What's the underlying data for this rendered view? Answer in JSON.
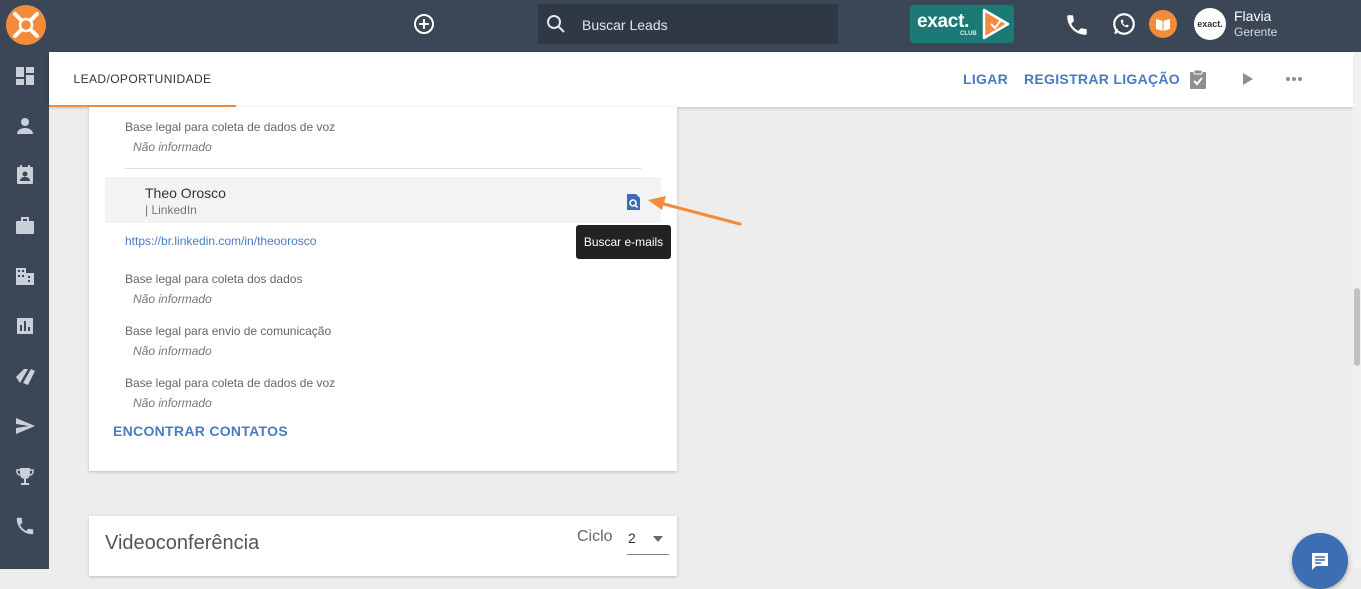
{
  "topbar": {
    "logo_icon": "exact-sales-logo-icon",
    "add_icon": "plus-circle-icon",
    "search_icon": "search-icon",
    "search_placeholder": "Buscar Leads",
    "club_brand": "exact.",
    "club_subtext": "CLUB",
    "phone_icon": "phone-icon",
    "whatsapp_icon": "whatsapp-icon",
    "learning_icon": "book-icon",
    "user_name": "Flavia",
    "user_role": "Gerente",
    "avatar_text": "exact."
  },
  "sidebar": {
    "items": [
      {
        "icon": "dashboard-icon"
      },
      {
        "icon": "person-icon"
      },
      {
        "icon": "contacts-icon"
      },
      {
        "icon": "briefcase-icon"
      },
      {
        "icon": "building-icon"
      },
      {
        "icon": "chart-icon"
      },
      {
        "icon": "tags-icon"
      },
      {
        "icon": "send-icon"
      },
      {
        "icon": "trophy-icon"
      },
      {
        "icon": "phone-icon"
      }
    ]
  },
  "header": {
    "tab_label": "LEAD/OPORTUNIDADE",
    "call_label": "LIGAR",
    "register_call_label": "REGISTRAR LIGAÇÃO",
    "task_icon": "clipboard-check-icon",
    "play_icon": "play-icon",
    "more_icon": "more-horizontal-icon"
  },
  "card": {
    "top_field": {
      "label": "Base legal para coleta de dados de voz",
      "value": "Não informado"
    },
    "contact": {
      "name": "Theo Orosco",
      "source": "| LinkedIn",
      "link": "https://br.linkedin.com/in/theoorosco",
      "search_icon": "search-document-icon"
    },
    "fields": [
      {
        "label": "Base legal para coleta dos dados",
        "value": "Não informado"
      },
      {
        "label": "Base legal para envio de comunicação",
        "value": "Não informado"
      },
      {
        "label": "Base legal para coleta de dados de voz",
        "value": "Não informado"
      }
    ],
    "find_contacts_label": "ENCONTRAR CONTATOS"
  },
  "tooltip": {
    "text": "Buscar e-mails"
  },
  "video": {
    "title": "Videoconferência",
    "ciclo_label": "Ciclo",
    "ciclo_value": "2"
  },
  "colors": {
    "topbar": "#3b4656",
    "accent_orange": "#f28c3b",
    "link_blue": "#4a7bbf",
    "club_teal": "#1b7a75"
  }
}
